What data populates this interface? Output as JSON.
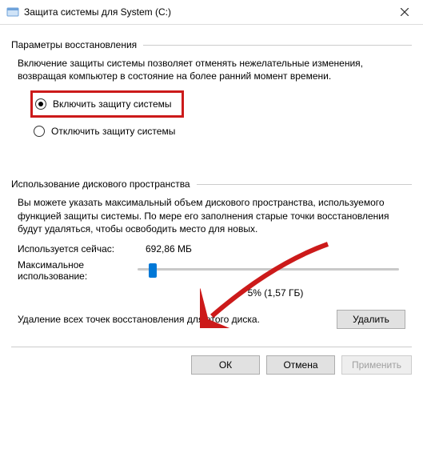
{
  "window": {
    "title": "Защита системы для System (C:)"
  },
  "restore": {
    "heading": "Параметры восстановления",
    "description": "Включение защиты системы позволяет отменять нежелательные изменения, возвращая компьютер в состояние на более ранний момент времени.",
    "option_enable": "Включить защиту системы",
    "option_disable": "Отключить защиту системы"
  },
  "disk": {
    "heading": "Использование дискового пространства",
    "description": "Вы можете указать максимальный объем дискового пространства, используемого функцией защиты системы. По мере его заполнения старые точки восстановления будут удаляться, чтобы освободить место для новых.",
    "current_label": "Используется сейчас:",
    "current_value": "692,86 МБ",
    "max_label": "Максимальное использование:",
    "slider_value": "5% (1,57 ГБ)",
    "delete_text": "Удаление всех точек восстановления для этого диска.",
    "delete_button": "Удалить"
  },
  "buttons": {
    "ok": "ОК",
    "cancel": "Отмена",
    "apply": "Применить"
  }
}
